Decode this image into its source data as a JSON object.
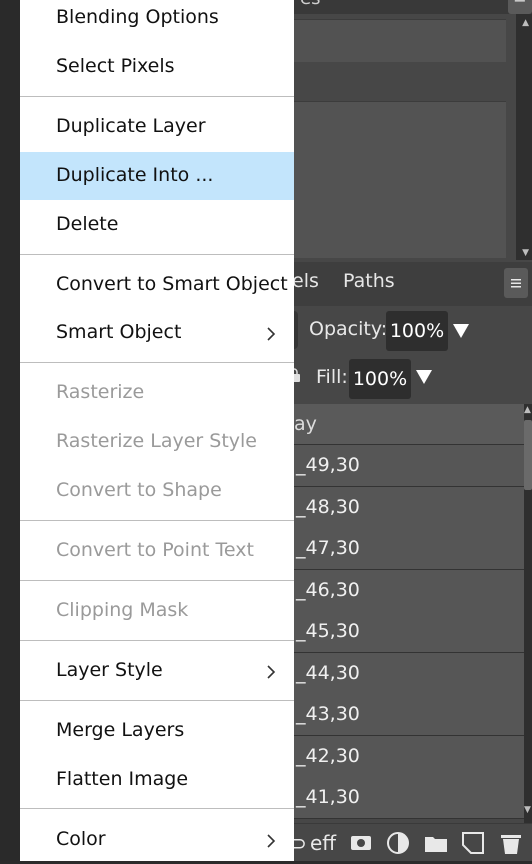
{
  "context_menu": {
    "items": [
      {
        "label": "Blending Options",
        "disabled": false
      },
      {
        "label": "Select Pixels",
        "disabled": false
      },
      {
        "label": "Duplicate Layer",
        "disabled": false
      },
      {
        "label": "Duplicate Into ...",
        "disabled": false,
        "highlighted": true
      },
      {
        "label": "Delete",
        "disabled": false
      },
      {
        "label": "Convert to Smart Object",
        "disabled": false
      },
      {
        "label": "Smart Object",
        "disabled": false,
        "submenu": true
      },
      {
        "label": "Rasterize",
        "disabled": true
      },
      {
        "label": "Rasterize Layer Style",
        "disabled": true
      },
      {
        "label": "Convert to Shape",
        "disabled": true
      },
      {
        "label": "Convert to Point Text",
        "disabled": true
      },
      {
        "label": "Clipping Mask",
        "disabled": true
      },
      {
        "label": "Layer Style",
        "disabled": false,
        "submenu": true
      },
      {
        "label": "Merge Layers",
        "disabled": false
      },
      {
        "label": "Flatten Image",
        "disabled": false
      },
      {
        "label": "Color",
        "disabled": false,
        "submenu": true
      }
    ]
  },
  "top_panel": {
    "partial_header": "es"
  },
  "layers_panel": {
    "tabs": [
      {
        "label": "els"
      },
      {
        "label": "Paths"
      }
    ],
    "menu_icon": "hamburger-icon",
    "opacity_label": "Opacity:",
    "opacity_value": "100%",
    "fill_label": "Fill:",
    "fill_value": "100%",
    "column_header": "ay",
    "layers": [
      "_49,30",
      "_48,30",
      "_47,30",
      "_46,30",
      "_45,30",
      "_44,30",
      "_43,30",
      "_42,30",
      "_41,30"
    ],
    "bottom_bar": {
      "effects_label": "eff",
      "icons": [
        "link-icon",
        "effects-icon",
        "mask-icon",
        "adjustment-icon",
        "folder-icon",
        "new-layer-icon",
        "trash-icon"
      ]
    }
  },
  "colors": {
    "menu_highlight": "#c3e5fc",
    "panel_bg": "#474747",
    "disabled_text": "#9a9a9a"
  }
}
